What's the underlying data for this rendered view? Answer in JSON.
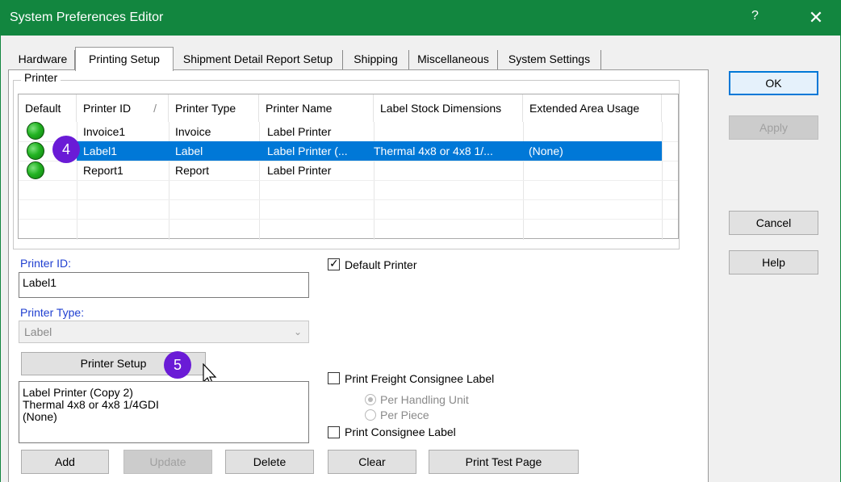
{
  "window": {
    "title": "System Preferences Editor",
    "help_glyph": "?",
    "close_glyph": "✕",
    "accent": "#12863f"
  },
  "tabs": [
    {
      "label": "Hardware"
    },
    {
      "label": "Printing Setup",
      "active": true
    },
    {
      "label": "Shipment Detail Report Setup"
    },
    {
      "label": "Shipping"
    },
    {
      "label": "Miscellaneous"
    },
    {
      "label": "System Settings"
    }
  ],
  "printer_group": {
    "label": "Printer",
    "columns": [
      "Default",
      "Printer ID",
      "Printer Type",
      "Printer Name",
      "Label Stock Dimensions",
      "Extended Area Usage"
    ],
    "sort_glyph": "/",
    "rows": [
      {
        "printer_id": "Invoice1",
        "type": "Invoice",
        "name": "Label  Printer",
        "dims": "",
        "ext": ""
      },
      {
        "printer_id": "Label1",
        "type": "Label",
        "name": "Label  Printer  (...",
        "dims": "Thermal 4x8 or 4x8 1/...",
        "ext": "(None)",
        "selected": true
      },
      {
        "printer_id": "Report1",
        "type": "Report",
        "name": "Label  Printer",
        "dims": "",
        "ext": ""
      }
    ]
  },
  "form": {
    "printer_id_label": "Printer ID:",
    "printer_id_value": "Label1",
    "printer_type_label": "Printer Type:",
    "printer_type_value": "Label",
    "printer_setup_button": "Printer Setup",
    "info_lines": [
      "Label Printer (Copy 2)",
      "Thermal 4x8 or 4x8 1/4GDI",
      "(None)"
    ],
    "default_printer_label": "Default Printer",
    "default_printer_checked": true,
    "print_freight_label": "Print Freight Consignee Label",
    "per_handling_unit": "Per Handling Unit",
    "per_piece": "Per Piece",
    "print_consignee_label": "Print Consignee Label"
  },
  "bottom_buttons": {
    "add": "Add",
    "update": "Update",
    "delete": "Delete",
    "clear": "Clear",
    "print_test": "Print Test Page"
  },
  "side_buttons": {
    "ok": "OK",
    "apply": "Apply",
    "cancel": "Cancel",
    "help": "Help"
  },
  "callouts": {
    "step4": "4",
    "step5": "5",
    "color": "#6a1bd6"
  },
  "icons": {
    "status_dot": "green-circle-icon",
    "cursor": "mouse-pointer-icon"
  }
}
